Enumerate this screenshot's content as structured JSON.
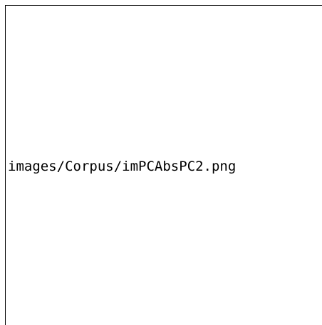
{
  "image": {
    "alt_text": "images/Corpus/imPCAbsPC2.png"
  },
  "colors": {
    "background": "#ffffff",
    "border": "#000000",
    "text": "#000000"
  }
}
